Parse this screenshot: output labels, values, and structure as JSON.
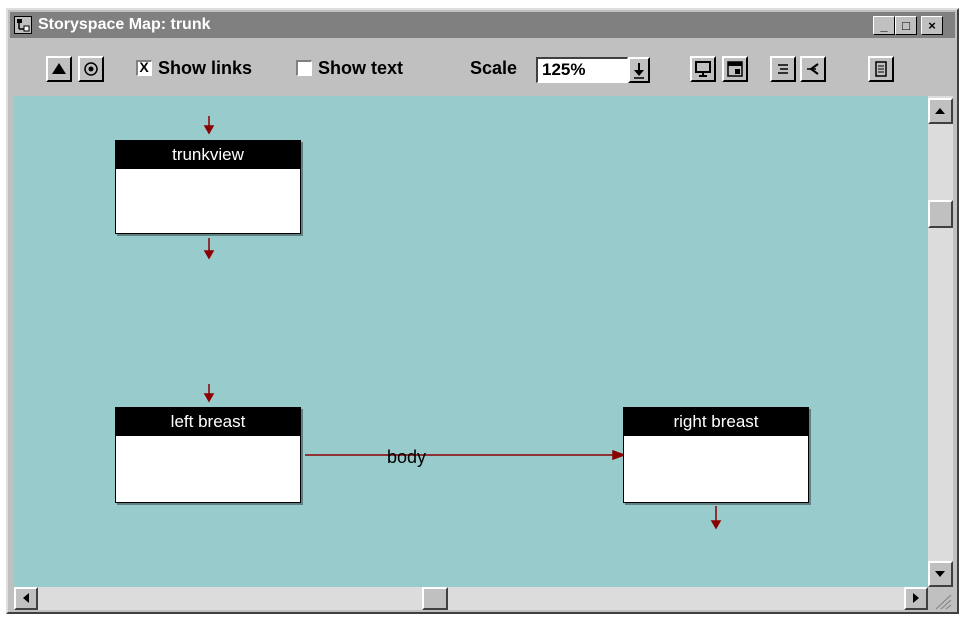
{
  "window": {
    "title": "Storyspace Map: trunk",
    "controls": {
      "minimize": "_",
      "maximize": "□",
      "close": "×"
    }
  },
  "toolbar": {
    "show_links": {
      "label": "Show links",
      "checked": true,
      "mark": "X"
    },
    "show_text": {
      "label": "Show text",
      "checked": false,
      "mark": ""
    },
    "scale_label": "Scale",
    "scale_value": "125%",
    "icons": [
      "up-arrow-icon",
      "target-icon",
      "monitor-icon",
      "window-layout-icon",
      "outline-list-icon",
      "link-back-icon",
      "page-icon"
    ]
  },
  "map": {
    "background": "#98cbcc",
    "link_color": "#8b0000",
    "nodes": [
      {
        "id": "trunkview",
        "title": "trunkview"
      },
      {
        "id": "left-breast",
        "title": "left breast"
      },
      {
        "id": "right-breast",
        "title": "right breast"
      }
    ],
    "links": [
      {
        "from": "left breast",
        "to": "right breast",
        "label": "body"
      }
    ]
  }
}
